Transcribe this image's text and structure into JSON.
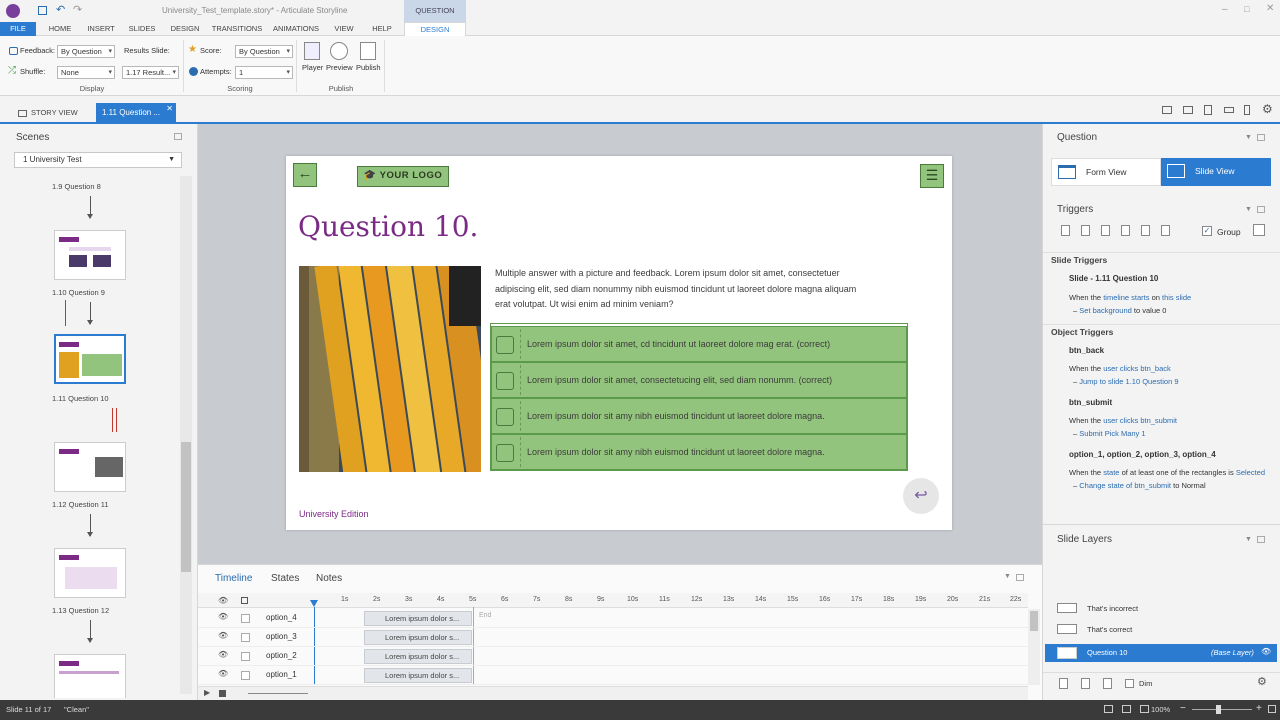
{
  "window": {
    "title": "University_Test_template.story* - Articulate Storyline",
    "context_tab": "QUESTION TOOLS"
  },
  "ribbon_tabs": [
    "FILE",
    "HOME",
    "INSERT",
    "SLIDES",
    "DESIGN",
    "TRANSITIONS",
    "ANIMATIONS",
    "VIEW",
    "HELP",
    "DESIGN"
  ],
  "ribbon": {
    "feedback_label": "Feedback:",
    "feedback_value": "By Question",
    "results_label": "Results Slide:",
    "results_value": "1.17 Result...",
    "shuffle_label": "Shuffle:",
    "shuffle_value": "None",
    "display_group": "Display",
    "score_label": "Score:",
    "score_value": "By Question",
    "attempts_label": "Attempts:",
    "attempts_value": "1",
    "scoring_group": "Scoring",
    "player": "Player",
    "preview": "Preview",
    "publish": "Publish",
    "publish_group": "Publish"
  },
  "view_tabs": {
    "story_view": "STORY VIEW",
    "slide_tab": "1.11 Question ..."
  },
  "scenes": {
    "title": "Scenes",
    "dropdown": "1 University Test",
    "items": [
      {
        "label": "1.9 Question 8"
      },
      {
        "label": "1.10 Question 9"
      },
      {
        "label": "1.11 Question 10"
      },
      {
        "label": "1.12 Question 11"
      },
      {
        "label": "1.13 Question 12"
      }
    ]
  },
  "slide": {
    "logo": "YOUR LOGO",
    "title": "Question 10.",
    "body": "Multiple answer with a picture and feedback. Lorem ipsum dolor sit amet, consectetuer adipiscing elit, sed diam nonummy nibh euismod tincidunt ut laoreet dolore magna aliquam erat volutpat. Ut wisi enim ad minim veniam?",
    "options": [
      "Lorem ipsum dolor sit amet, cd tincidunt ut laoreet dolore mag erat. (correct)",
      "Lorem ipsum dolor sit amet, consectetucing elit, sed diam nonumm. (correct)",
      "Lorem ipsum dolor sit amy nibh euismod tincidunt ut laoreet dolore magna.",
      "Lorem ipsum dolor sit amy nibh euismod tincidunt ut laoreet dolore magna."
    ],
    "footer": "University Edition"
  },
  "timeline": {
    "tabs": [
      "Timeline",
      "States",
      "Notes"
    ],
    "ticks": [
      "1s",
      "2s",
      "3s",
      "4s",
      "5s",
      "6s",
      "7s",
      "8s",
      "9s",
      "10s",
      "11s",
      "12s",
      "13s",
      "14s",
      "15s",
      "16s",
      "17s",
      "18s",
      "19s",
      "20s",
      "21s",
      "22s"
    ],
    "end_label": "End",
    "rows": [
      {
        "name": "option_4",
        "bar": "Lorem ipsum dolor s..."
      },
      {
        "name": "option_3",
        "bar": "Lorem ipsum dolor s..."
      },
      {
        "name": "option_2",
        "bar": "Lorem ipsum dolor s..."
      },
      {
        "name": "option_1",
        "bar": "Lorem ipsum dolor s..."
      }
    ]
  },
  "right_panel": {
    "question_title": "Question",
    "form_view": "Form View",
    "slide_view": "Slide View",
    "triggers_title": "Triggers",
    "group_label": "Group",
    "slide_triggers": "Slide Triggers",
    "slide_trigger_name": "Slide - 1.11 Question 10",
    "st_when_a": "When the",
    "st_when_b": "timeline starts",
    "st_when_c": "on",
    "st_when_d": "this slide",
    "st_action_a": "Set",
    "st_action_b": "background",
    "st_action_c": "to value 0",
    "object_triggers": "Object Triggers",
    "t1_name": "btn_back",
    "t1_when_a": "When the",
    "t1_when_b": "user clicks",
    "t1_when_c": "btn_back",
    "t1_action_a": "Jump to slide",
    "t1_action_b": "1.10 Question 9",
    "t2_name": "btn_submit",
    "t2_when_a": "When the",
    "t2_when_b": "user clicks",
    "t2_when_c": "btn_submit",
    "t2_action_a": "Submit",
    "t2_action_b": "Pick Many 1",
    "t3_name": "option_1, option_2, option_3, option_4",
    "t3_when_a": "When the",
    "t3_when_b": "state",
    "t3_when_c": "of at least one of the rectangles is",
    "t3_when_d": "Selected",
    "t3_action_a": "Change state of",
    "t3_action_b": "btn_submit",
    "t3_action_c": "to Normal",
    "layers_title": "Slide Layers",
    "layers": [
      {
        "name": "That's incorrect"
      },
      {
        "name": "That's correct"
      }
    ],
    "base_layer_name": "Question 10",
    "base_layer_tag": "(Base Layer)",
    "dim_label": "Dim"
  },
  "status": {
    "slide": "Slide 11 of 17",
    "theme": "\"Clean\"",
    "zoom": "100%"
  },
  "colors": {
    "accent": "#2b7bd1",
    "title_purple": "#7b2a86",
    "option_green": "#93c47d"
  }
}
